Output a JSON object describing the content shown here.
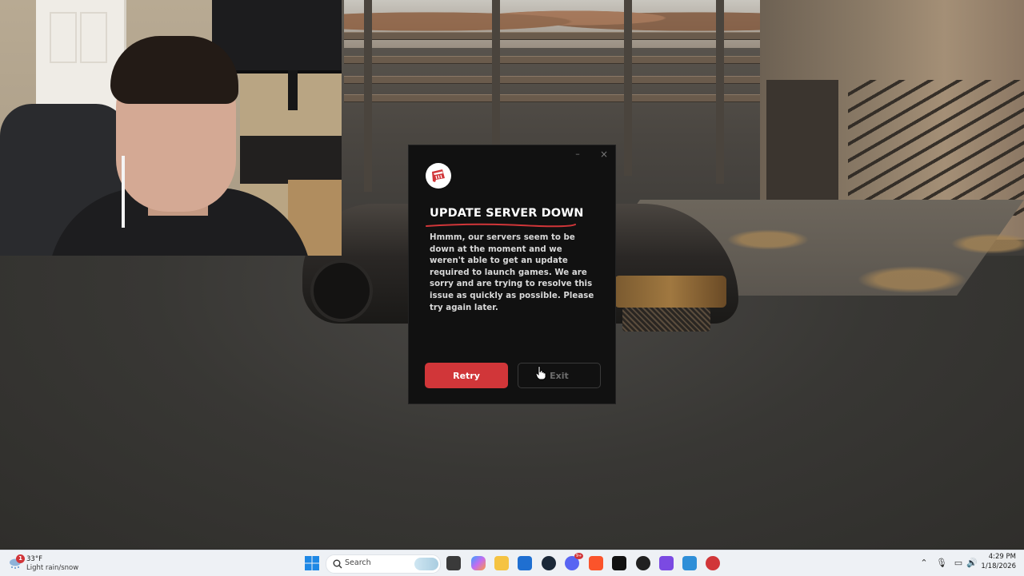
{
  "dialog": {
    "title": "UPDATE SERVER DOWN",
    "message": "Hmmm, our servers seem to be down at the moment and we weren't able to get an update required to launch games. We are sorry and are trying to resolve this issue as quickly as possible. Please try again later.",
    "retry_label": "Retry",
    "exit_label": "Exit",
    "minimize_glyph": "–",
    "close_glyph": "×",
    "accent_color": "#d13639",
    "logo_icon": "riot-fist-icon"
  },
  "taskbar": {
    "weather": {
      "badge": "1",
      "temperature": "33°F",
      "condition": "Light rain/snow"
    },
    "search_placeholder": "Search",
    "notification_badge": "9+",
    "clock": {
      "time": "4:29 PM",
      "date": "1/18/2026"
    },
    "pinned_icons": [
      "start-icon",
      "file-manager-icon",
      "copilot-icon",
      "file-explorer-icon",
      "store-icon",
      "steam-icon",
      "discord-icon",
      "brave-icon",
      "epic-games-icon",
      "chatgpt-icon",
      "visual-studio-icon",
      "photos-icon",
      "riot-client-icon"
    ],
    "tray_icons": [
      "chevron-up-icon",
      "microphone-icon",
      "display-icon",
      "volume-icon"
    ]
  }
}
